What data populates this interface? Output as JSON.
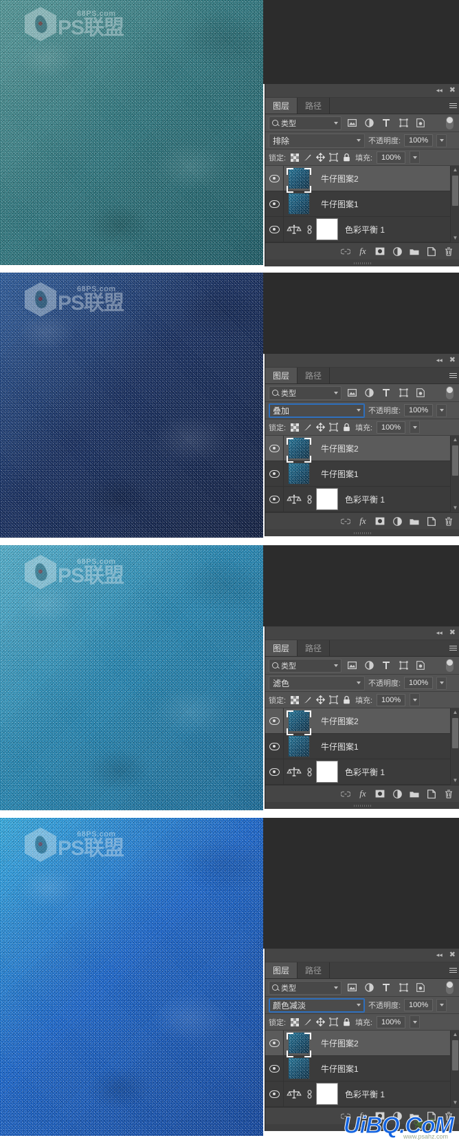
{
  "watermark": {
    "domain": "68PS.com",
    "name": "PS联盟",
    "corner": "UiBQ.CoM",
    "corner_sub": "www.psahz.com"
  },
  "panel": {
    "tabs": [
      {
        "label": "图层",
        "active": true
      },
      {
        "label": "路径",
        "active": false
      }
    ],
    "filter": {
      "select_label": "类型",
      "icons": [
        "image-filter-icon",
        "adjustment-filter-icon",
        "text-filter-icon",
        "shape-filter-icon",
        "smartobject-filter-icon"
      ],
      "toggle": "filter-enable-toggle"
    },
    "opacity_label": "不透明度:",
    "opacity_value": "100%",
    "lock_label": "锁定:",
    "lock_icons": [
      "lock-transparency-icon",
      "lock-image-icon",
      "lock-position-icon",
      "lock-artboard-icon",
      "lock-all-icon"
    ],
    "fill_label": "填充:",
    "fill_value": "100%",
    "layers": [
      {
        "name": "牛仔图案2",
        "selected": true,
        "type": "pixel"
      },
      {
        "name": "牛仔图案1",
        "selected": false,
        "type": "pixel"
      },
      {
        "name": "色彩平衡 1",
        "selected": false,
        "type": "adjustment"
      }
    ],
    "bottom_icons": [
      "link-layers-icon",
      "layer-style-fx-icon",
      "add-mask-icon",
      "new-adjustment-layer-icon",
      "new-group-icon",
      "new-layer-icon",
      "delete-layer-icon"
    ],
    "collapse_icon": "collapse-panel-icon",
    "close_icon": "close-panel-icon",
    "menu_icon": "panel-menu-icon"
  },
  "steps": [
    {
      "id": "step-1",
      "blend_mode": "排除",
      "blend_focused": false,
      "canvas_color_base": "#2b7d86",
      "canvas_color_dark": "#165d69",
      "canvas_color_light": "#56a3a4"
    },
    {
      "id": "step-2",
      "blend_mode": "叠加",
      "blend_focused": true,
      "canvas_color_base": "#0f2a63",
      "canvas_color_dark": "#081840",
      "canvas_color_light": "#2a5fa8"
    },
    {
      "id": "step-3",
      "blend_mode": "滤色",
      "blend_focused": false,
      "canvas_color_base": "#1f8ec0",
      "canvas_color_dark": "#1470a3",
      "canvas_color_light": "#55bede"
    },
    {
      "id": "step-4",
      "blend_mode": "颜色减淡",
      "blend_focused": true,
      "canvas_color_base": "#1469dc",
      "canvas_color_dark": "#0b45a8",
      "canvas_color_light": "#32b9f5"
    }
  ],
  "colors": {
    "panel_bg": "#3b3b3b",
    "panel_shell": "#535353",
    "selected_row": "#5b5b5b",
    "focus_blue": "#2e6fbd",
    "text": "#e4e4e4"
  }
}
